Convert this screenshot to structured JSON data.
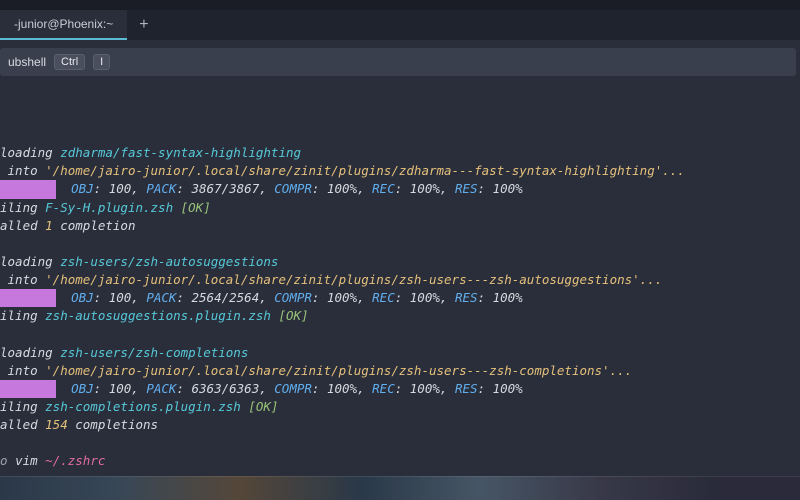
{
  "tab": {
    "title": "-junior@Phoenix:~"
  },
  "newtab_glyph": "+",
  "infobar": {
    "text": "ubshell",
    "key1": "Ctrl",
    "key2": "I"
  },
  "blocks": [
    {
      "loading": "zdharma/fast-syntax-highlighting",
      "path": "'/home/jairo-junior/.local/share/zinit/plugins/zdharma---fast-syntax-highlighting'...",
      "stats": {
        "obj": "100",
        "pack": "3867/3867",
        "compr": "100%",
        "rec": "100%",
        "res": "100%"
      },
      "compiling": "F-Sy-H.plugin.zsh",
      "ok": "[OK]",
      "installed_count": "1",
      "installed_word": "completion"
    },
    {
      "loading": "zsh-users/zsh-autosuggestions",
      "path": "'/home/jairo-junior/.local/share/zinit/plugins/zsh-users---zsh-autosuggestions'...",
      "stats": {
        "obj": "100",
        "pack": "2564/2564",
        "compr": "100%",
        "rec": "100%",
        "res": "100%"
      },
      "compiling": "zsh-autosuggestions.plugin.zsh",
      "ok": "[OK]"
    },
    {
      "loading": "zsh-users/zsh-completions",
      "path": "'/home/jairo-junior/.local/share/zinit/plugins/zsh-users---zsh-completions'...",
      "stats": {
        "obj": "100",
        "pack": "6363/6363",
        "compr": "100%",
        "rec": "100%",
        "res": "100%"
      },
      "compiling": "zsh-completions.plugin.zsh",
      "ok": "[OK]",
      "installed_count": "154",
      "installed_word": "completions"
    }
  ],
  "labels": {
    "loading_prefix": "loading ",
    "into_prefix": " into ",
    "obj": "OBJ",
    "pack": "PACK",
    "compr": "COMPR",
    "rec": "REC",
    "res": "RES",
    "compiling_prefix": "iling ",
    "installed_prefix": "alled "
  },
  "prompt": {
    "prefix": "o ",
    "cmd": "vim ",
    "arg": "~/.zshrc"
  }
}
